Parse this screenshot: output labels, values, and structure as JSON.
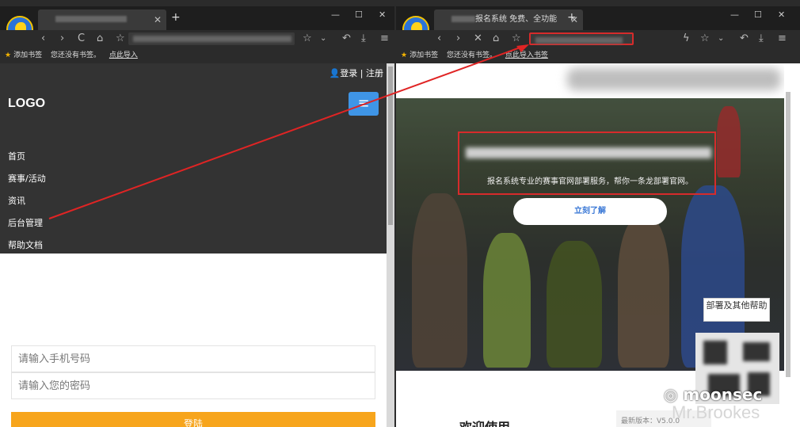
{
  "left_window": {
    "tab_title": "",
    "new_tab": "+",
    "controls": {
      "min": "—",
      "max": "☐",
      "close": "✕"
    },
    "nav": {
      "back": "‹",
      "forward": "›",
      "reload": "C",
      "home": "⌂",
      "extra": "☆"
    },
    "bookmarks": {
      "add": "添加书签",
      "none": "您还没有书签。",
      "import": "点此导入"
    },
    "page": {
      "login_links": "👤登录 | 注册",
      "logo": "LOGO",
      "menu_icon": "≡",
      "nav_items": [
        "首页",
        "赛事/活动",
        "资讯",
        "后台管理",
        "帮助文档"
      ],
      "phone_placeholder": "请输入手机号码",
      "password_placeholder": "请输入您的密码",
      "login_button": "登陆"
    }
  },
  "right_window": {
    "tab_title": "报名系统 免费、全功能",
    "new_tab": "+",
    "controls": {
      "min": "—",
      "max": "☐",
      "close": "✕"
    },
    "nav": {
      "back": "‹",
      "forward": "›",
      "stop": "✕",
      "home": "⌂",
      "star": "☆"
    },
    "bookmarks": {
      "add": "添加书签",
      "none": "您还没有书签。",
      "import": "点此导入书签"
    },
    "page": {
      "hero_sub": "报名系统专业的赛事官网部署服务，帮你一条龙部署官网。",
      "cta": "立刻了解",
      "help": "部署及其他帮助",
      "welcome": "欢迎使用",
      "version": "最新版本：V5.0.0"
    }
  },
  "watermarks": {
    "line1": "moonsec",
    "line2": "Mr.Brookes"
  },
  "colors": {
    "accent_blue": "#3f95e6",
    "login_orange": "#f7a51c",
    "annotation_red": "#d62b2b"
  }
}
